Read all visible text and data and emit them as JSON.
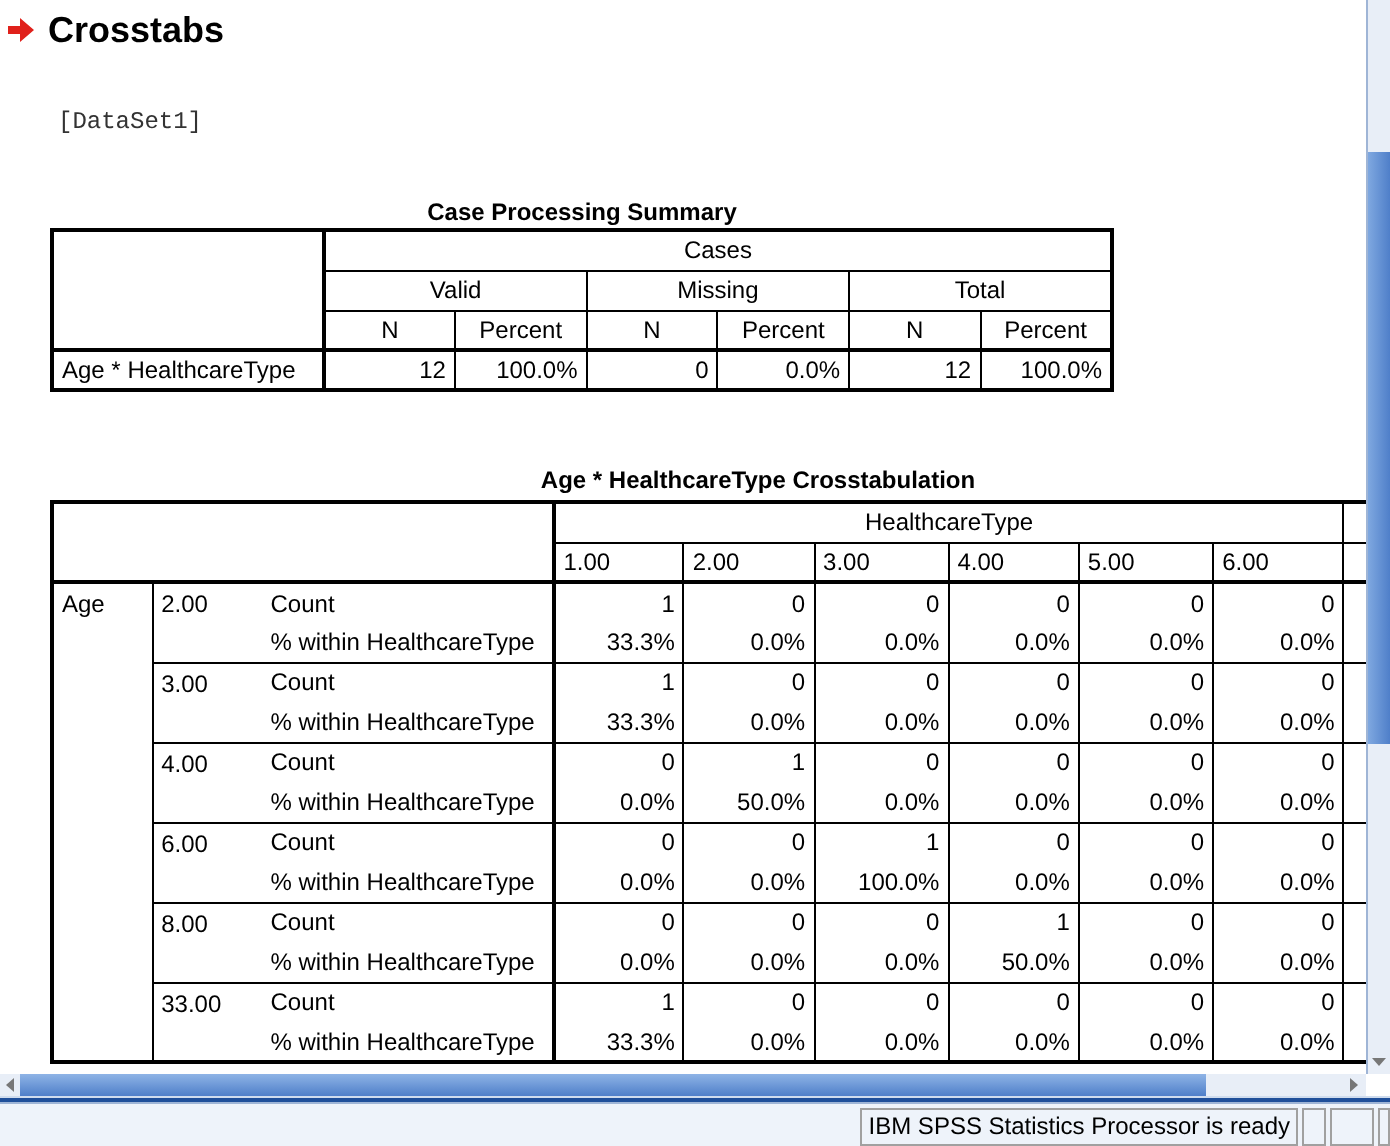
{
  "heading": "Crosstabs",
  "dataset": "[DataSet1]",
  "summary": {
    "title": "Case Processing Summary",
    "group": "Cases",
    "subgroups": [
      "Valid",
      "Missing",
      "Total"
    ],
    "columns": [
      "N",
      "Percent",
      "N",
      "Percent",
      "N",
      "Percent"
    ],
    "rows": [
      {
        "label": "Age * HealthcareType",
        "values": [
          "12",
          "100.0%",
          "0",
          "0.0%",
          "12",
          "100.0%"
        ]
      }
    ]
  },
  "crosstab": {
    "title": "Age * HealthcareType Crosstabulation",
    "row_variable": "Age",
    "column_variable": "HealthcareType",
    "columns": [
      "1.00",
      "2.00",
      "3.00",
      "4.00",
      "5.00",
      "6.00"
    ],
    "groups": [
      {
        "value": "2.00",
        "rows": [
          {
            "label": "Count",
            "values": [
              "1",
              "0",
              "0",
              "0",
              "0",
              "0"
            ]
          },
          {
            "label": "% within HealthcareType",
            "values": [
              "33.3%",
              "0.0%",
              "0.0%",
              "0.0%",
              "0.0%",
              "0.0%"
            ]
          }
        ]
      },
      {
        "value": "3.00",
        "rows": [
          {
            "label": "Count",
            "values": [
              "1",
              "0",
              "0",
              "0",
              "0",
              "0"
            ]
          },
          {
            "label": "% within HealthcareType",
            "values": [
              "33.3%",
              "0.0%",
              "0.0%",
              "0.0%",
              "0.0%",
              "0.0%"
            ]
          }
        ]
      },
      {
        "value": "4.00",
        "rows": [
          {
            "label": "Count",
            "values": [
              "0",
              "1",
              "0",
              "0",
              "0",
              "0"
            ]
          },
          {
            "label": "% within HealthcareType",
            "values": [
              "0.0%",
              "50.0%",
              "0.0%",
              "0.0%",
              "0.0%",
              "0.0%"
            ]
          }
        ]
      },
      {
        "value": "6.00",
        "rows": [
          {
            "label": "Count",
            "values": [
              "0",
              "0",
              "1",
              "0",
              "0",
              "0"
            ]
          },
          {
            "label": "% within HealthcareType",
            "values": [
              "0.0%",
              "0.0%",
              "100.0%",
              "0.0%",
              "0.0%",
              "0.0%"
            ]
          }
        ]
      },
      {
        "value": "8.00",
        "rows": [
          {
            "label": "Count",
            "values": [
              "0",
              "0",
              "0",
              "1",
              "0",
              "0"
            ]
          },
          {
            "label": "% within HealthcareType",
            "values": [
              "0.0%",
              "0.0%",
              "0.0%",
              "50.0%",
              "0.0%",
              "0.0%"
            ]
          }
        ]
      },
      {
        "value": "33.00",
        "rows": [
          {
            "label": "Count",
            "values": [
              "1",
              "0",
              "0",
              "0",
              "0",
              "0"
            ]
          },
          {
            "label": "% within HealthcareType",
            "values": [
              "33.3%",
              "0.0%",
              "0.0%",
              "0.0%",
              "0.0%",
              "0.0%"
            ]
          }
        ]
      }
    ]
  },
  "status_bar": {
    "message": "IBM SPSS Statistics Processor is ready"
  }
}
